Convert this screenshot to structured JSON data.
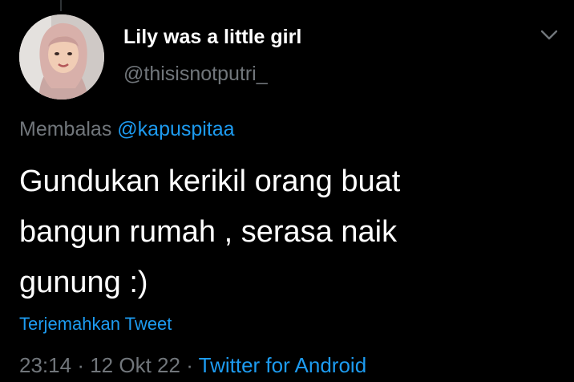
{
  "tweet": {
    "display_name": "Lily was a little girl",
    "handle": "@thisisnotputri_",
    "reply_prefix": "Membalas",
    "reply_to": "@kapuspitaa",
    "text_lines": [
      "Gundukan kerikil orang buat",
      "bangun rumah , serasa naik",
      "gunung :)"
    ],
    "translate_label": "Terjemahkan Tweet",
    "time": "23:14",
    "date": "12 Okt 22",
    "separator": "·",
    "source": "Twitter for Android"
  },
  "icons": {
    "more": "chevron-down-icon",
    "avatar": "profile-photo"
  },
  "colors": {
    "background": "#000000",
    "text": "#ffffff",
    "secondary": "#71767b",
    "link": "#1d9bf0"
  }
}
